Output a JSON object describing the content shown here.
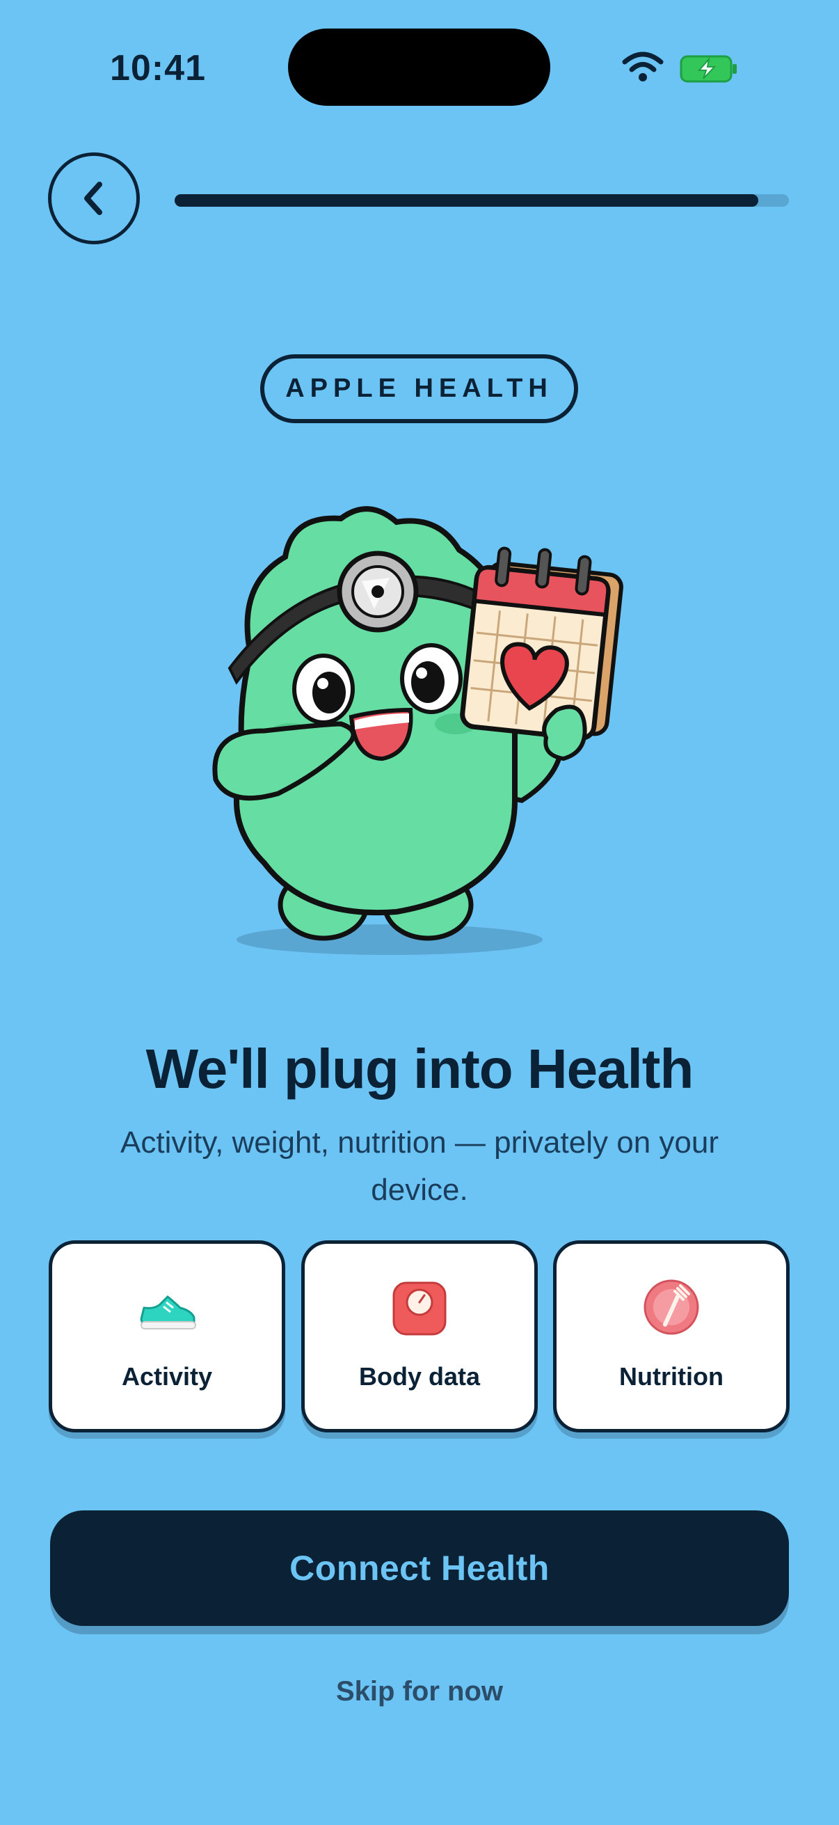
{
  "status_bar": {
    "time": "10:41",
    "wifi_icon": "wifi-icon",
    "battery_icon": "battery-charging-icon"
  },
  "header": {
    "back_icon": "chevron-left-icon",
    "progress": 0.95
  },
  "chip": {
    "label": "APPLE HEALTH"
  },
  "illustration": {
    "name": "doctor-mascot-with-heart-calendar"
  },
  "content": {
    "title": "We'll plug into Health",
    "subtitle": "Activity, weight, nutrition — privately on your device."
  },
  "cards": [
    {
      "label": "Activity",
      "icon": "sneaker-icon"
    },
    {
      "label": "Body data",
      "icon": "scale-icon"
    },
    {
      "label": "Nutrition",
      "icon": "plate-fork-icon"
    }
  ],
  "actions": {
    "primary": "Connect Health",
    "secondary": "Skip for now"
  },
  "colors": {
    "background": "#6CC4F5",
    "ink": "#0B2236",
    "mascot": "#66DDA3",
    "card": "#FFFFFF"
  }
}
